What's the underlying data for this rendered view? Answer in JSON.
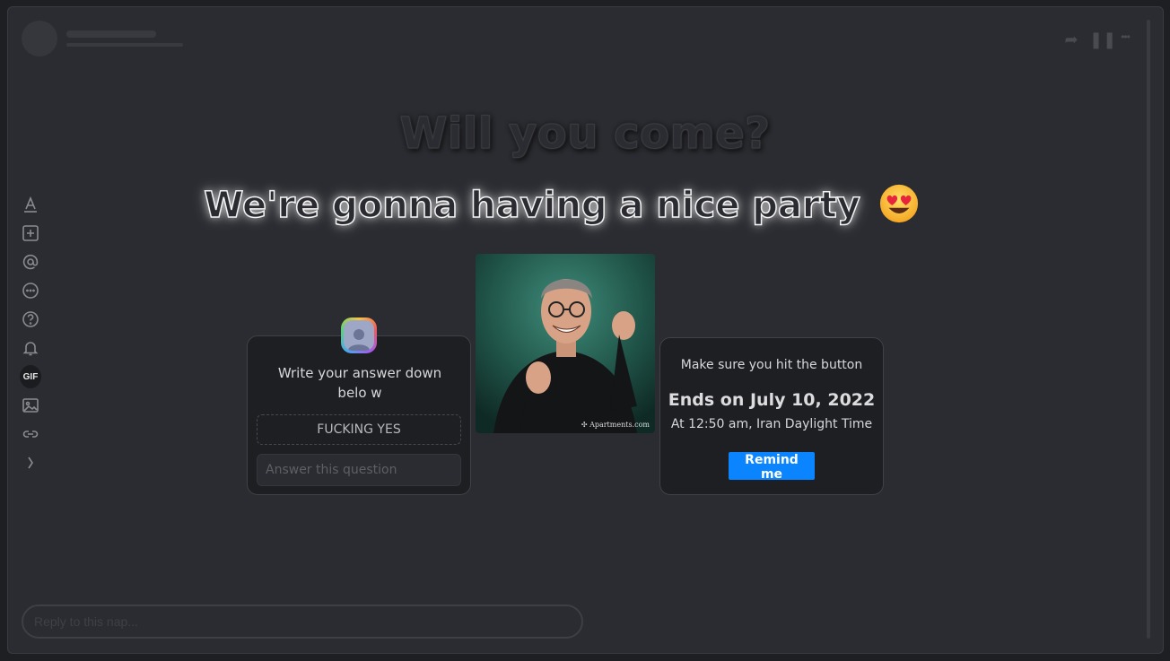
{
  "header": {
    "actions": [
      {
        "name": "share-icon",
        "glyph": "➦"
      },
      {
        "name": "pause-icon",
        "glyph": "❚❚"
      },
      {
        "name": "more-icon",
        "glyph": "•••"
      }
    ]
  },
  "toolbar": {
    "items": [
      {
        "name": "text-icon"
      },
      {
        "name": "add-icon"
      },
      {
        "name": "mention-icon"
      },
      {
        "name": "chat-icon"
      },
      {
        "name": "question-icon"
      },
      {
        "name": "bell-icon"
      },
      {
        "name": "gif-button",
        "label": "GIF"
      },
      {
        "name": "image-icon"
      },
      {
        "name": "link-icon"
      },
      {
        "name": "chevron-right-icon"
      }
    ]
  },
  "story": {
    "headline": "Will you come?",
    "subhead": "We're gonna having a nice party",
    "subhead_emoji": "heart-eyes-emoji"
  },
  "question_card": {
    "title": "Write your answer down belo w",
    "answer": "FUCKING YES",
    "input_placeholder": "Answer this question"
  },
  "gif": {
    "watermark": "Apartments.com"
  },
  "countdown_card": {
    "title": "Make sure you hit the button",
    "ends": "Ends on July 10, 2022",
    "time": "At 12:50 am, Iran Daylight Time",
    "button": "Remind me",
    "button_color": "#0a84ff"
  },
  "reply": {
    "placeholder": "Reply to this nap..."
  }
}
